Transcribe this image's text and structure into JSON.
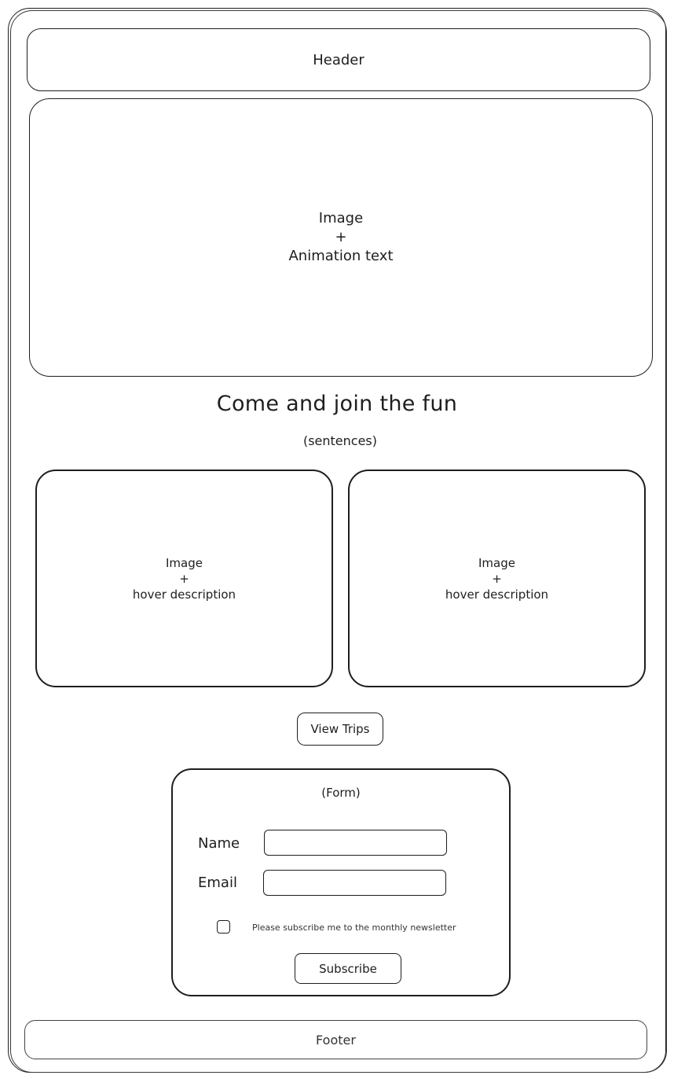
{
  "header": {
    "label": "Header"
  },
  "hero": {
    "line1": "Image",
    "line2": "+",
    "line3": "Animation text"
  },
  "intro": {
    "title": "Come and join the fun",
    "subtitle": "(sentences)"
  },
  "cards": [
    {
      "line1": "Image",
      "line2": "+",
      "line3": "hover description"
    },
    {
      "line1": "Image",
      "line2": "+",
      "line3": "hover description"
    }
  ],
  "view_trips": {
    "label": "View Trips"
  },
  "form": {
    "title": "(Form)",
    "name_label": "Name",
    "email_label": "Email",
    "newsletter_label": "Please subscribe me to the monthly newsletter",
    "subscribe_label": "Subscribe"
  },
  "footer": {
    "label": "Footer"
  }
}
